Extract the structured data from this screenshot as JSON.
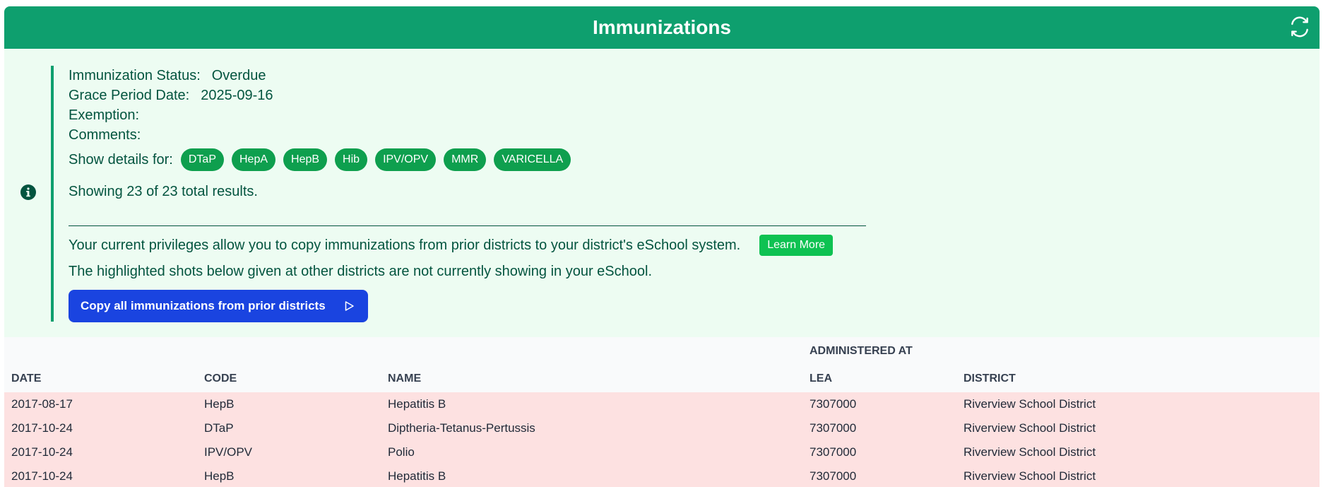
{
  "header": {
    "title": "Immunizations",
    "refresh_icon": "refresh-icon"
  },
  "status": {
    "immunization_status_label": "Immunization Status:",
    "immunization_status_value": "Overdue",
    "grace_period_label": "Grace Period Date:",
    "grace_period_value": "2025-09-16",
    "exemption_label": "Exemption:",
    "comments_label": "Comments:",
    "show_details_label": "Show details for:",
    "chips": [
      "DTaP",
      "HepA",
      "HepB",
      "Hib",
      "IPV/OPV",
      "MMR",
      "VARICELLA"
    ],
    "showing_text": "Showing 23 of 23 total results."
  },
  "privileges": {
    "message": "Your current privileges allow you to copy immunizations from prior districts to your district's eSchool system.",
    "learn_more_label": "Learn More",
    "highlight_message": "The highlighted shots below given at other districts are not currently showing in your eSchool.",
    "copy_button_label": "Copy all immunizations from prior districts"
  },
  "table": {
    "group_header": "ADMINISTERED AT",
    "columns": [
      "DATE",
      "CODE",
      "NAME",
      "LEA",
      "DISTRICT"
    ],
    "rows": [
      [
        "2017-08-17",
        "HepB",
        "Hepatitis B",
        "7307000",
        "Riverview School District"
      ],
      [
        "2017-10-24",
        "DTaP",
        "Diptheria-Tetanus-Pertussis",
        "7307000",
        "Riverview School District"
      ],
      [
        "2017-10-24",
        "IPV/OPV",
        "Polio",
        "7307000",
        "Riverview School District"
      ],
      [
        "2017-10-24",
        "HepB",
        "Hepatitis B",
        "7307000",
        "Riverview School District"
      ]
    ]
  },
  "colors": {
    "header_bg": "#0e9f6e",
    "panel_bg": "#edfcf2",
    "text_green": "#03543f",
    "chip_green": "#0e9f4e",
    "copy_button_blue": "#1a44e0",
    "highlight_row": "#fde1e1"
  }
}
